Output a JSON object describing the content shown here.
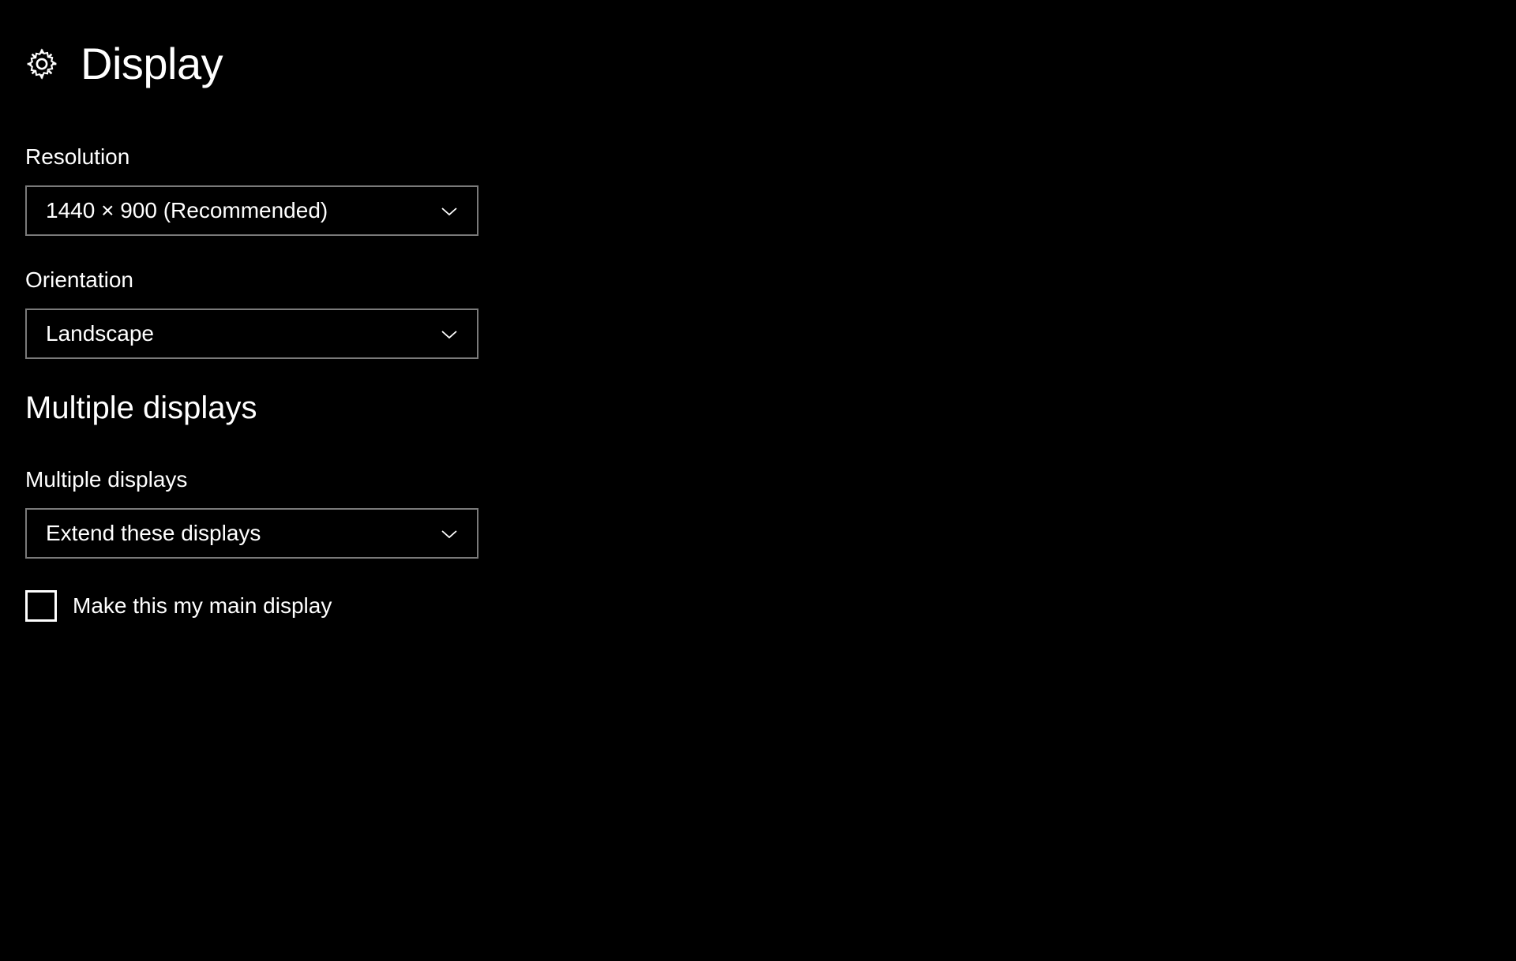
{
  "header": {
    "title": "Display"
  },
  "resolution": {
    "label": "Resolution",
    "value": "1440 × 900 (Recommended)"
  },
  "orientation": {
    "label": "Orientation",
    "value": "Landscape"
  },
  "multipleDisplays": {
    "sectionHeading": "Multiple displays",
    "label": "Multiple displays",
    "value": "Extend these displays"
  },
  "mainDisplay": {
    "label": "Make this my main display",
    "checked": false
  }
}
